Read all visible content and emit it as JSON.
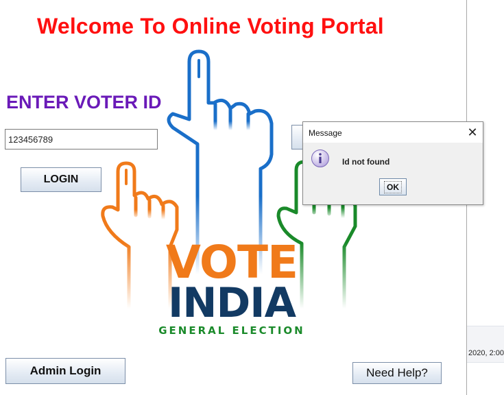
{
  "main": {
    "title": "Welcome To Online Voting Portal",
    "voter_label": "ENTER VOTER ID",
    "voter_input_value": "123456789",
    "login_label": "LOGIN",
    "admin_login_label": "Admin Login",
    "need_help_label": "Need Help?"
  },
  "logo": {
    "line1": "VOTE",
    "line2": "INDIA",
    "tagline": "GENERAL ELECTION"
  },
  "dialog": {
    "title": "Message",
    "message": "Id not found",
    "ok_label": "OK",
    "close_glyph": "✕"
  },
  "side_panel": {
    "text": "2020, 2:00:"
  },
  "colors": {
    "title": "#ff1010",
    "voter_label": "#6a1ab8",
    "saffron": "#f07a1a",
    "blue": "#1a6fc9",
    "green": "#1a8a2a",
    "navy": "#123a63"
  },
  "icons": {
    "dialog_icon": "info-icon",
    "close": "close-icon"
  }
}
